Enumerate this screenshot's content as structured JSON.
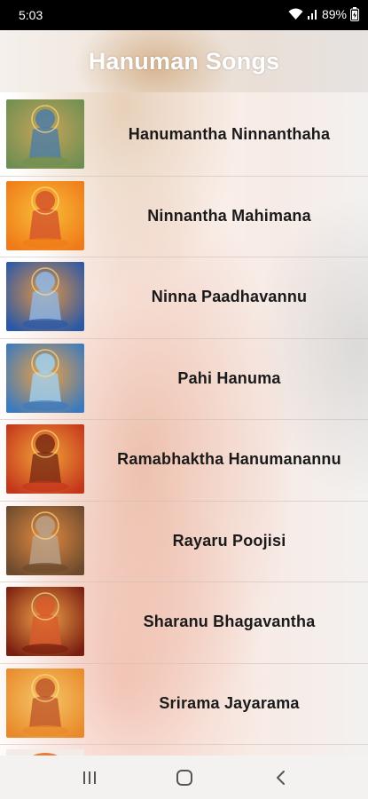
{
  "status_bar": {
    "time": "5:03",
    "battery": "89%",
    "icons": [
      "wifi-icon",
      "signal-icon",
      "battery-icon"
    ]
  },
  "app_bar": {
    "title": "Hanuman Songs"
  },
  "songs": [
    {
      "title": "Hanumantha Ninnanthaha",
      "thumb_colors": [
        "#6f8f52",
        "#c9a45a",
        "#4c7da6"
      ]
    },
    {
      "title": "Ninnantha Mahimana",
      "thumb_colors": [
        "#f07a18",
        "#f7c03a",
        "#d4532a"
      ]
    },
    {
      "title": "Ninna Paadhavannu",
      "thumb_colors": [
        "#2a58a8",
        "#e49540",
        "#8fb7e6"
      ]
    },
    {
      "title": "Pahi Hanuma",
      "thumb_colors": [
        "#3a7ac0",
        "#f0a040",
        "#9fd0f0"
      ]
    },
    {
      "title": "Ramabhaktha Hanumanannu",
      "thumb_colors": [
        "#c4361c",
        "#f2a43a",
        "#7a2a14"
      ]
    },
    {
      "title": "Rayaru Poojisi",
      "thumb_colors": [
        "#6b4a2e",
        "#e48a40",
        "#b8a18a"
      ]
    },
    {
      "title": "Sharanu Bhagavantha",
      "thumb_colors": [
        "#7a1e10",
        "#f0a04a",
        "#d85a2a"
      ]
    },
    {
      "title": "Srirama Jayarama",
      "thumb_colors": [
        "#e9892a",
        "#f6c86a",
        "#c0582a"
      ]
    }
  ],
  "nav_bar": {
    "icons": [
      "recent-apps-icon",
      "home-icon",
      "back-icon"
    ]
  }
}
